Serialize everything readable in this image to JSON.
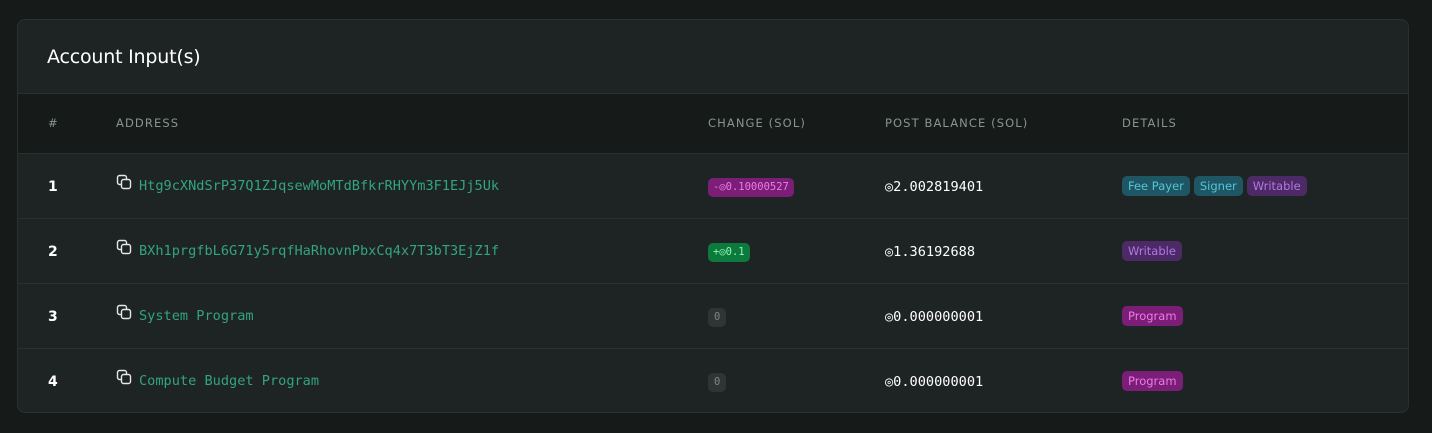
{
  "card": {
    "title": "Account Input(s)"
  },
  "table": {
    "headers": {
      "idx": "#",
      "address": "ADDRESS",
      "change": "CHANGE (SOL)",
      "post_balance": "POST BALANCE (SOL)",
      "details": "DETAILS"
    },
    "rows": [
      {
        "idx": "1",
        "address": "Htg9cXNdSrP37Q1ZJqsewMoMTdBfkrRHYYm3F1EJj5Uk",
        "change": "-◎0.10000527",
        "change_kind": "negative",
        "post_balance": "◎2.002819401",
        "badges": [
          "Fee Payer",
          "Signer",
          "Writable"
        ]
      },
      {
        "idx": "2",
        "address": "BXh1prgfbL6G71y5rqfHaRhovnPbxCq4x7T3bT3EjZ1f",
        "change": "+◎0.1",
        "change_kind": "positive",
        "post_balance": "◎1.36192688",
        "badges": [
          "Writable"
        ]
      },
      {
        "idx": "3",
        "address": "System Program",
        "change": "0",
        "change_kind": "zero",
        "post_balance": "◎0.000000001",
        "badges": [
          "Program"
        ]
      },
      {
        "idx": "4",
        "address": "Compute Budget Program",
        "change": "0",
        "change_kind": "zero",
        "post_balance": "◎0.000000001",
        "badges": [
          "Program"
        ]
      }
    ]
  },
  "icons": {
    "copy": "copy-icon"
  },
  "colors": {
    "background": "#161a19",
    "card": "#1e2423",
    "address_link": "#33a382",
    "negative_badge": "#7b1e77",
    "positive_badge": "#0c7a3c",
    "signer_badge": "#1f5663",
    "writable_badge": "#4b2a66"
  }
}
